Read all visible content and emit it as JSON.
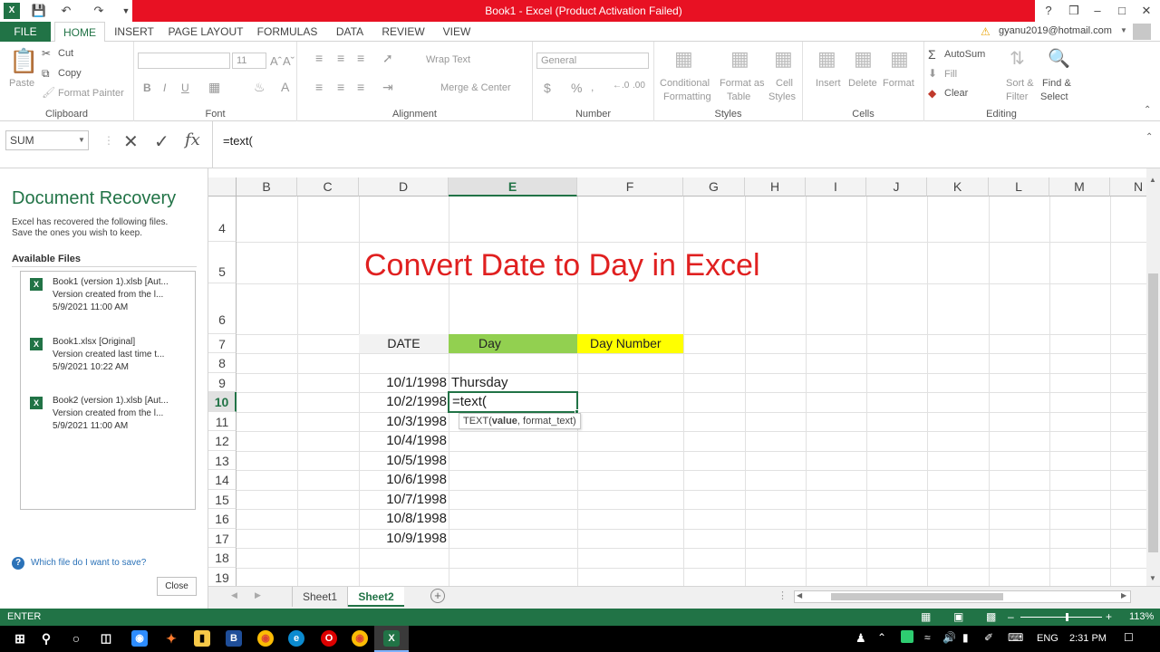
{
  "window": {
    "title": "Book1  -  Excel (Product Activation Failed)",
    "help": "?",
    "controls": [
      "❒",
      "–",
      "□",
      "✕"
    ]
  },
  "tabs": [
    "FILE",
    "HOME",
    "INSERT",
    "PAGE LAYOUT",
    "FORMULAS",
    "DATA",
    "REVIEW",
    "VIEW"
  ],
  "account": "gyanu2019@hotmail.com",
  "ribbon": {
    "clipboard": {
      "paste": "Paste",
      "cut": "Cut",
      "copy": "Copy",
      "format_painter": "Format Painter",
      "label": "Clipboard"
    },
    "font": {
      "size": "11",
      "bold": "B",
      "italic": "I",
      "underline": "U",
      "label": "Font"
    },
    "alignment": {
      "wrap": "Wrap Text",
      "merge": "Merge & Center",
      "label": "Alignment"
    },
    "number": {
      "format": "General",
      "currency": "$",
      "percent": "%",
      "label": "Number"
    },
    "styles": {
      "conditional": "Conditional",
      "conditional2": "Formatting",
      "format_as": "Format as",
      "format_as2": "Table",
      "cell": "Cell",
      "cell2": "Styles",
      "label": "Styles"
    },
    "cells": {
      "insert": "Insert",
      "delete": "Delete",
      "format": "Format",
      "label": "Cells"
    },
    "editing": {
      "autosum": "AutoSum",
      "fill": "Fill",
      "clear": "Clear",
      "sort": "Sort &",
      "sort2": "Filter",
      "find": "Find &",
      "find2": "Select",
      "label": "Editing"
    }
  },
  "formula_bar": {
    "name_box": "SUM",
    "formula": "=text("
  },
  "doc_recovery": {
    "title": "Document Recovery",
    "desc1": "Excel has recovered the following files.",
    "desc2": "Save the ones you wish to keep.",
    "available": "Available Files",
    "files": [
      {
        "name": "Book1 (version 1).xlsb  [Aut...",
        "info": "Version created from the l...",
        "time": "5/9/2021 11:00 AM"
      },
      {
        "name": "Book1.xlsx  [Original]",
        "info": "Version created last time t...",
        "time": "5/9/2021 10:22 AM"
      },
      {
        "name": "Book2 (version 1).xlsb  [Aut...",
        "info": "Version created from the l...",
        "time": "5/9/2021 11:00 AM"
      }
    ],
    "help_link": "Which file do I want to save?",
    "close": "Close"
  },
  "grid": {
    "columns": [
      "B",
      "C",
      "D",
      "E",
      "F",
      "G",
      "H",
      "I",
      "J",
      "K",
      "L",
      "M",
      "N"
    ],
    "rows": [
      "4",
      "5",
      "6",
      "7",
      "8",
      "9",
      "10",
      "11",
      "12",
      "13",
      "14",
      "15",
      "16",
      "17",
      "18",
      "19"
    ],
    "title": "Convert Date to Day in Excel",
    "headers": {
      "date": "DATE",
      "day": "Day",
      "day_number": "Day Number"
    },
    "dates": [
      "10/1/1998",
      "10/2/1998",
      "10/3/1998",
      "10/4/1998",
      "10/5/1998",
      "10/6/1998",
      "10/7/1998",
      "10/8/1998",
      "10/9/1998"
    ],
    "e9": "Thursday",
    "editing_cell": "=text(",
    "tooltip_fn": "TEXT(",
    "tooltip_arg1": "value",
    "tooltip_rest": ", format_text)",
    "colors": {
      "day_header": "#92d050",
      "day_number_header": "#ffff00",
      "title": "#e02020"
    }
  },
  "sheets": [
    "Sheet1",
    "Sheet2"
  ],
  "status": {
    "mode": "ENTER",
    "zoom": "113%"
  },
  "taskbar": {
    "lang": "ENG",
    "time": "2:31 PM"
  }
}
